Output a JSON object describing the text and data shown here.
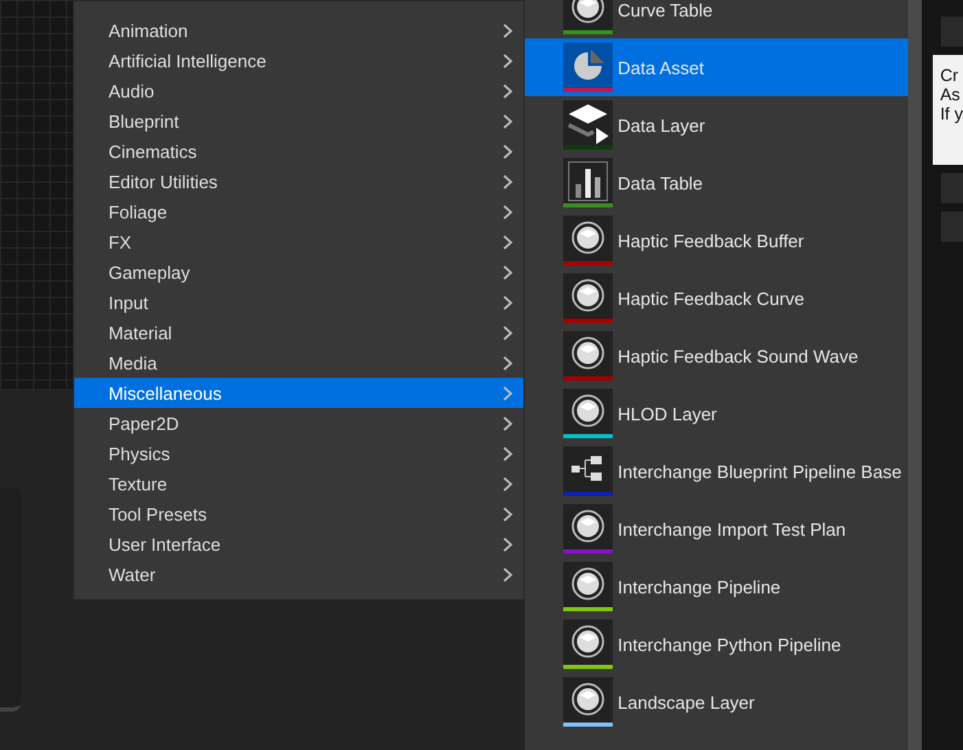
{
  "categories": [
    {
      "label": "Animation",
      "selected": false
    },
    {
      "label": "Artificial Intelligence",
      "selected": false
    },
    {
      "label": "Audio",
      "selected": false
    },
    {
      "label": "Blueprint",
      "selected": false
    },
    {
      "label": "Cinematics",
      "selected": false
    },
    {
      "label": "Editor Utilities",
      "selected": false
    },
    {
      "label": "Foliage",
      "selected": false
    },
    {
      "label": "FX",
      "selected": false
    },
    {
      "label": "Gameplay",
      "selected": false
    },
    {
      "label": "Input",
      "selected": false
    },
    {
      "label": "Material",
      "selected": false
    },
    {
      "label": "Media",
      "selected": false
    },
    {
      "label": "Miscellaneous",
      "selected": true
    },
    {
      "label": "Paper2D",
      "selected": false
    },
    {
      "label": "Physics",
      "selected": false
    },
    {
      "label": "Texture",
      "selected": false
    },
    {
      "label": "Tool Presets",
      "selected": false
    },
    {
      "label": "User Interface",
      "selected": false
    },
    {
      "label": "Water",
      "selected": false
    }
  ],
  "assets": [
    {
      "label": "Curve Table",
      "kind": "cube",
      "color": "#3a8f1e",
      "selected": false
    },
    {
      "label": "Data Asset",
      "kind": "pie",
      "color": "#c0184e",
      "selected": true
    },
    {
      "label": "Data Layer",
      "kind": "layers",
      "color": "#0e3a0e",
      "selected": false
    },
    {
      "label": "Data Table",
      "kind": "bars",
      "color": "#3a8f1e",
      "selected": false
    },
    {
      "label": "Haptic Feedback Buffer",
      "kind": "cube",
      "color": "#a80000",
      "selected": false
    },
    {
      "label": "Haptic Feedback Curve",
      "kind": "cube",
      "color": "#a80000",
      "selected": false
    },
    {
      "label": "Haptic Feedback Sound Wave",
      "kind": "cube",
      "color": "#a80000",
      "selected": false
    },
    {
      "label": "HLOD Layer",
      "kind": "cube",
      "color": "#00c0c8",
      "selected": false
    },
    {
      "label": "Interchange Blueprint Pipeline Base",
      "kind": "nodes",
      "color": "#0a20b8",
      "selected": false
    },
    {
      "label": "Interchange Import Test Plan",
      "kind": "cube",
      "color": "#8a10c8",
      "selected": false
    },
    {
      "label": "Interchange Pipeline",
      "kind": "cube",
      "color": "#80c810",
      "selected": false
    },
    {
      "label": "Interchange Python Pipeline",
      "kind": "cube",
      "color": "#80c810",
      "selected": false
    },
    {
      "label": "Landscape Layer",
      "kind": "cube",
      "color": "#80c0ff",
      "selected": false
    }
  ],
  "tooltip": {
    "lines": [
      "Cr",
      "As",
      "If y"
    ]
  }
}
